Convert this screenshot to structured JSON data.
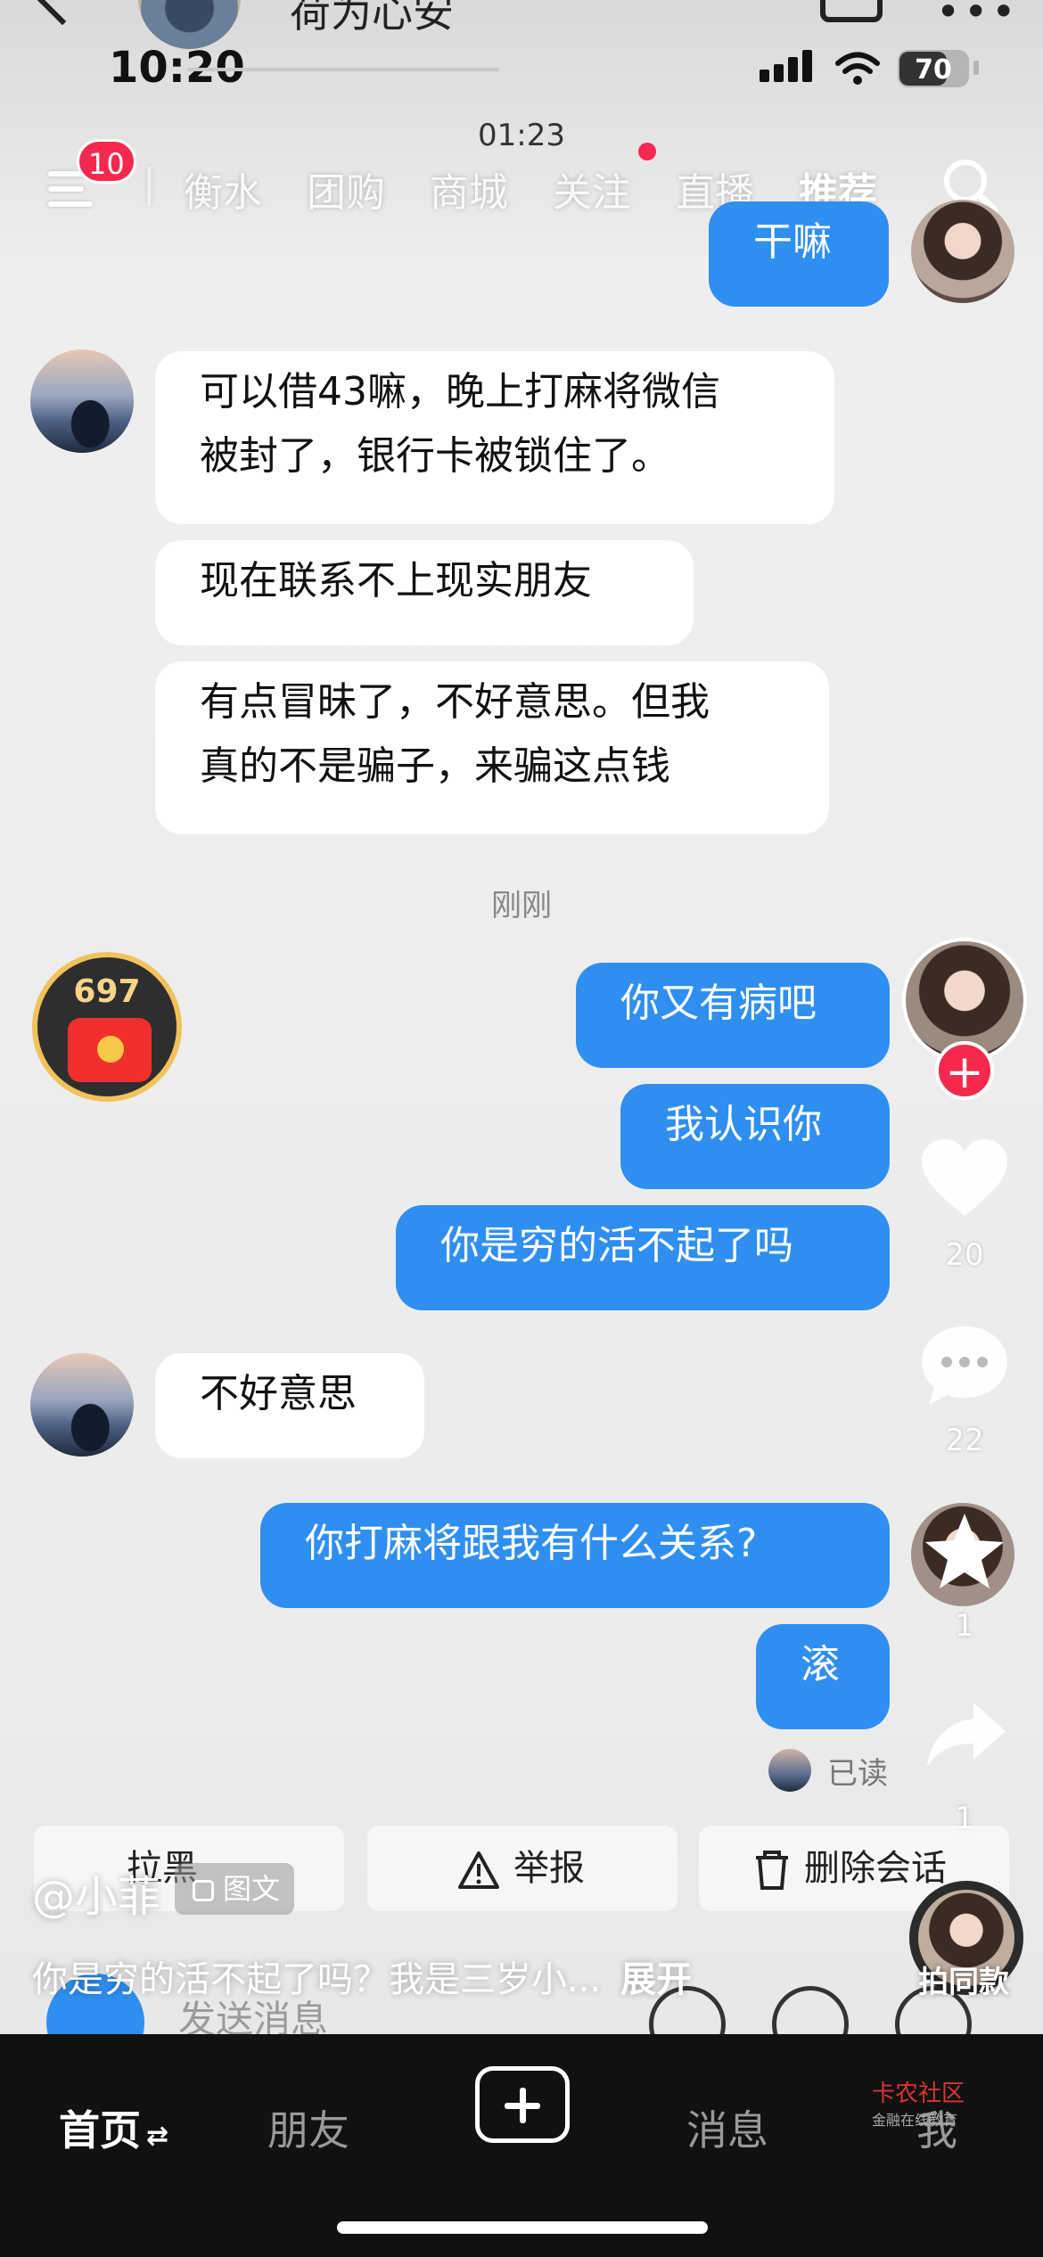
{
  "chat_header": {
    "name": "荷为心安"
  },
  "status_bar": {
    "time": "10:20",
    "battery": "70",
    "battery_level": 0.7
  },
  "video": {
    "timer": "01:23"
  },
  "top_nav": {
    "menu_badge": "10",
    "tabs": [
      {
        "label": "衡水"
      },
      {
        "label": "团购"
      },
      {
        "label": "商城"
      },
      {
        "label": "关注"
      },
      {
        "label": "直播"
      },
      {
        "label": "推荐"
      }
    ],
    "active_tab": "推荐"
  },
  "messages": [
    {
      "side": "out",
      "text": "干嘛"
    },
    {
      "side": "in",
      "text": "可以借43嘛，晚上打麻将微信被封了，银行卡被锁住了。"
    },
    {
      "side": "in",
      "text": "现在联系不上现实朋友"
    },
    {
      "side": "in",
      "text": "有点冒昧了，不好意思。但我真的不是骗子，来骗这点钱"
    },
    {
      "side": "out",
      "text": "你又有病吧"
    },
    {
      "side": "out",
      "text": "我认识你"
    },
    {
      "side": "out",
      "text": "你是穷的活不起了吗"
    },
    {
      "side": "in",
      "text": "不好意思"
    },
    {
      "side": "out",
      "text": "你打麻将跟我有什么关系?"
    },
    {
      "side": "out",
      "text": "滚"
    }
  ],
  "msg_lines": {
    "m1_l1": "可以借43嘛，晚上打麻将微信",
    "m1_l2": "被封了，银行卡被锁住了。",
    "m3_l1": "有点冒昧了，不好意思。但我",
    "m3_l2": "真的不是骗子，来骗这点钱"
  },
  "timestamp": "刚刚",
  "read_status": "已读",
  "red_packet": {
    "count": "697"
  },
  "actions": {
    "likes": "20",
    "comments": "22",
    "favorites": "1",
    "shares": "1"
  },
  "chat_tools": {
    "block": "拉黑",
    "report": "举报",
    "delete": "删除会话",
    "input_placeholder": "发送消息"
  },
  "post": {
    "author": "@小菲",
    "type_tag": "图文",
    "caption": "你是穷的活不起了吗？我是三岁小...",
    "expand": "展开",
    "same_style": "拍同款"
  },
  "tab_bar": {
    "home": "首页",
    "friends": "朋友",
    "messages": "消息",
    "me": "我"
  },
  "watermark": {
    "title": "卡农社区",
    "subtitle": "金融在线教育"
  },
  "colors": {
    "bubble_out": "#2f8ff0",
    "bubble_in": "#ffffff",
    "badge": "#f5284e",
    "tab_bar_bg": "#111111"
  },
  "icons": [
    "back-icon",
    "video-call-icon",
    "more-icon",
    "signal-icon",
    "wifi-icon",
    "battery-icon",
    "menu-icon",
    "search-icon",
    "heart-icon",
    "comment-icon",
    "star-icon",
    "share-icon",
    "camera-icon",
    "voice-icon",
    "emoji-icon",
    "plus-icon"
  ]
}
